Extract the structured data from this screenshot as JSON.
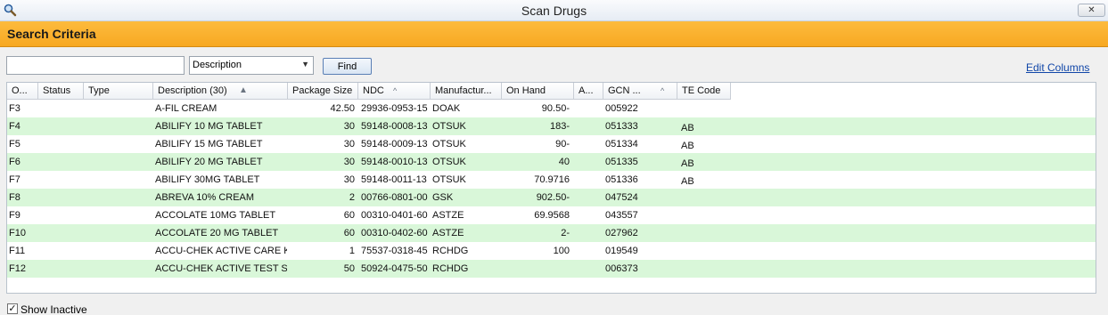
{
  "window": {
    "title": "Scan Drugs",
    "close_glyph": "✕"
  },
  "header": {
    "title": "Search Criteria"
  },
  "search": {
    "value": "",
    "field_select": "Description",
    "find_label": "Find",
    "edit_columns_label": "Edit Columns"
  },
  "table": {
    "columns": [
      "O...",
      "Status",
      "Type",
      "Description (30)",
      "Package Size",
      "NDC",
      "Manufactur...",
      "On Hand",
      "A...",
      "GCN ...",
      "TE Code"
    ],
    "rows": [
      [
        "F3",
        "",
        "",
        "A-FIL CREAM",
        "42.50",
        "29936-0953-15",
        "DOAK",
        "90.50-",
        "",
        "005922",
        ""
      ],
      [
        "F4",
        "",
        "",
        "ABILIFY 10 MG TABLET",
        "30",
        "59148-0008-13",
        "OTSUK",
        "183-",
        "",
        "051333",
        "AB"
      ],
      [
        "F5",
        "",
        "",
        "ABILIFY 15 MG TABLET",
        "30",
        "59148-0009-13",
        "OTSUK",
        "90-",
        "",
        "051334",
        "AB"
      ],
      [
        "F6",
        "",
        "",
        "ABILIFY 20 MG TABLET",
        "30",
        "59148-0010-13",
        "OTSUK",
        "40",
        "",
        "051335",
        "AB"
      ],
      [
        "F7",
        "",
        "",
        "ABILIFY 30MG TABLET",
        "30",
        "59148-0011-13",
        "OTSUK",
        "70.9716",
        "",
        "051336",
        "AB"
      ],
      [
        "F8",
        "",
        "",
        "ABREVA 10% CREAM",
        "2",
        "00766-0801-00",
        "GSK",
        "902.50-",
        "",
        "047524",
        ""
      ],
      [
        "F9",
        "",
        "",
        "ACCOLATE 10MG TABLET",
        "60",
        "00310-0401-60",
        "ASTZE",
        "69.9568",
        "",
        "043557",
        ""
      ],
      [
        "F10",
        "",
        "",
        "ACCOLATE 20 MG TABLET",
        "60",
        "00310-0402-60",
        "ASTZE",
        "2-",
        "",
        "027962",
        ""
      ],
      [
        "F11",
        "",
        "",
        "ACCU-CHEK ACTIVE CARE KIT",
        "1",
        "75537-0318-45",
        "RCHDG",
        "100",
        "",
        "019549",
        ""
      ],
      [
        "F12",
        "",
        "",
        "ACCU-CHEK ACTIVE TEST STR",
        "50",
        "50924-0475-50",
        "RCHDG",
        "",
        "",
        "006373",
        ""
      ]
    ]
  },
  "footer": {
    "show_inactive_label": "Show Inactive",
    "show_inactive_checked": true,
    "check_glyph": "✓"
  },
  "colors": {
    "header_orange": "#f9ad2b",
    "row_alt_green": "#d9f7d9",
    "link_blue": "#1046a8"
  },
  "icons": {
    "title": "magnifier-icon",
    "sort_up": "sort-ascending-icon"
  }
}
